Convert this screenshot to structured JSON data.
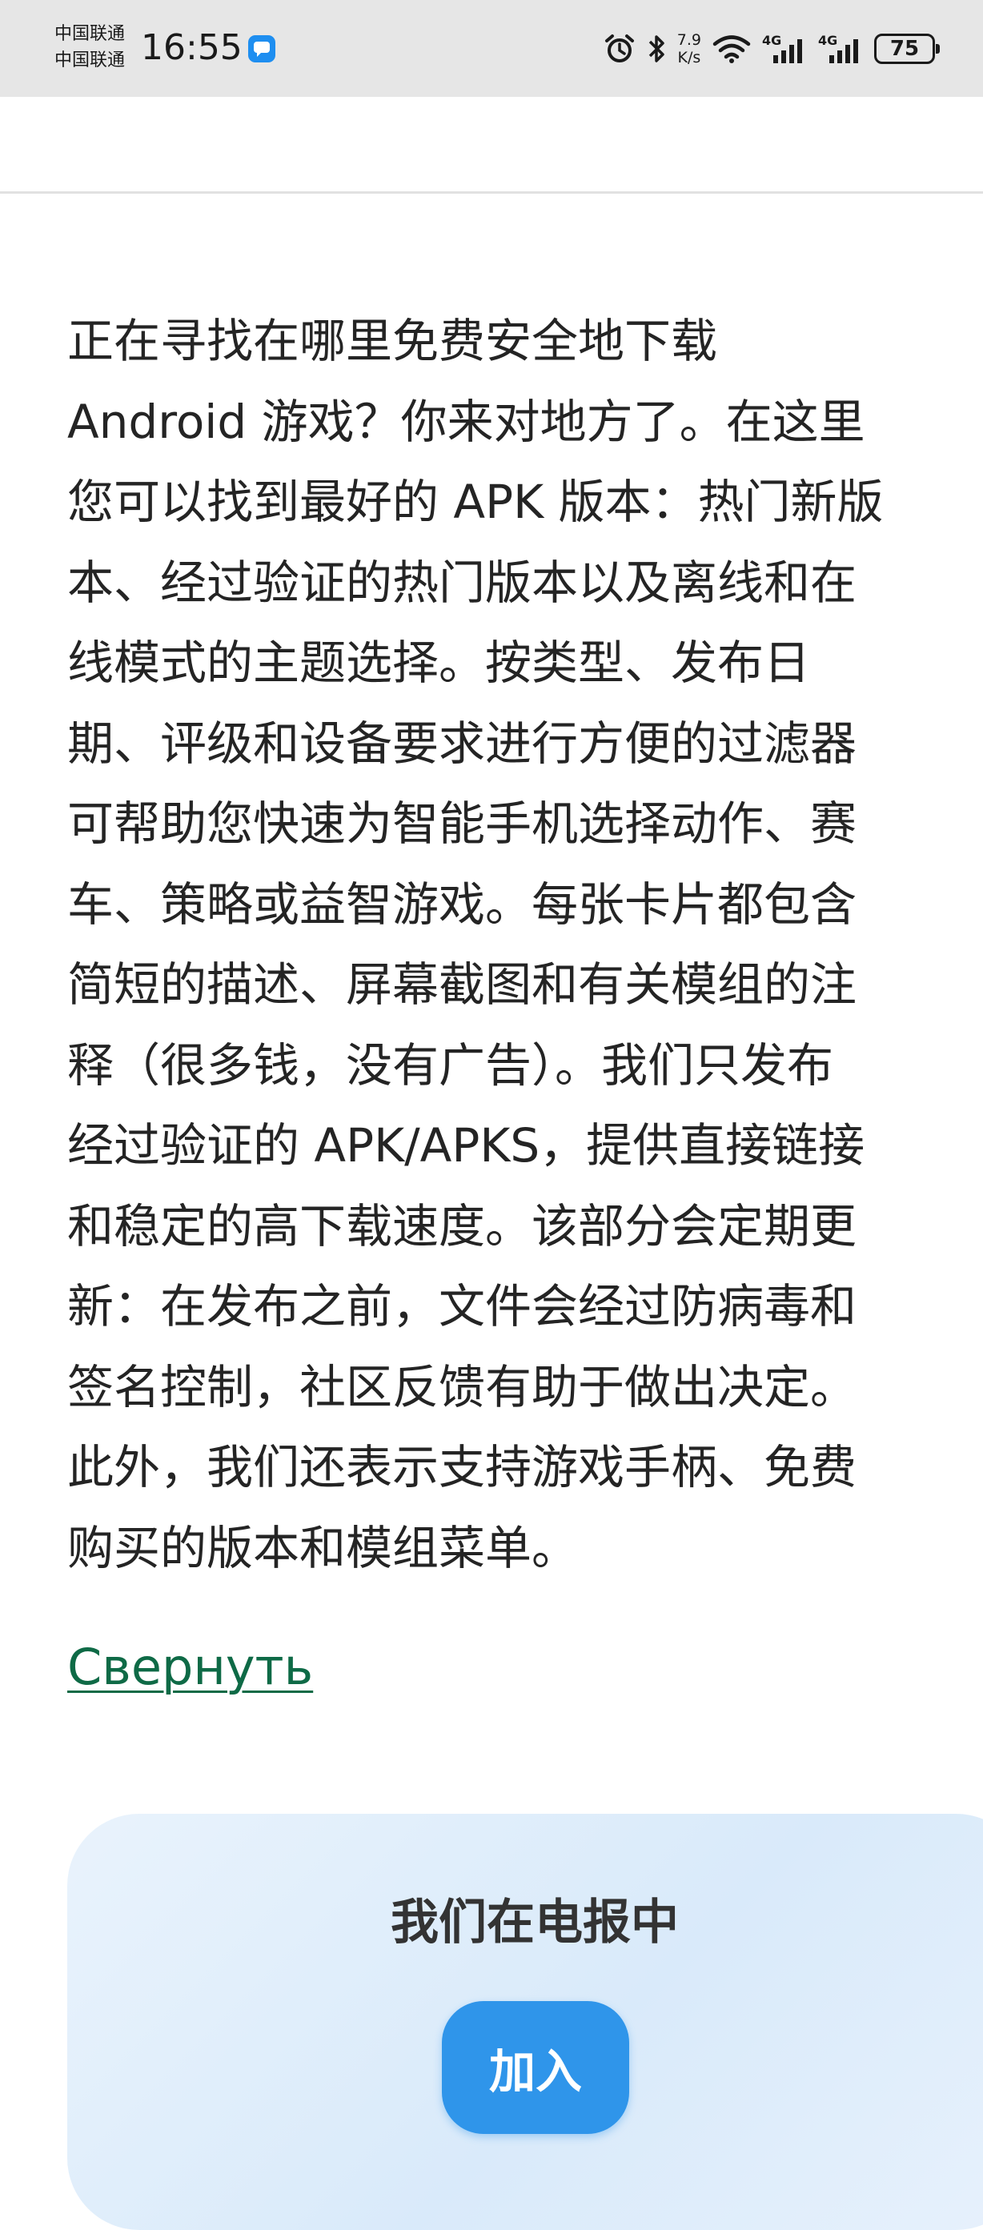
{
  "status_bar": {
    "carrier_1": "中国联通",
    "carrier_2": "中国联通",
    "time": "16:55",
    "net_speed_value": "7.9",
    "net_speed_unit": "K/s",
    "network_1": "4G",
    "network_2": "4G",
    "battery": "75",
    "icons": [
      "message-icon",
      "alarm-icon",
      "bluetooth-icon",
      "wifi-icon",
      "signal-icon",
      "battery-icon"
    ]
  },
  "description": {
    "lines": [
      "正在寻找在哪里免费安全地下载",
      "Android 游戏？你来对地方了。在这里",
      "您可以找到最好的 APK 版本：热门新版",
      "本、经过验证的热门版本以及离线和在",
      "线模式的主题选择。按类型、发布日",
      "期、评级和设备要求进行方便的过滤器",
      "可帮助您快速为智能手机选择动作、赛",
      "车、策略或益智游戏。每张卡片都包含",
      "简短的描述、屏幕截图和有关模组的注",
      "释（很多钱，没有广告）。我们只发布",
      "经过验证的 APK/APKS，提供直接链接",
      "和稳定的高下载速度。该部分会定期更",
      "新：在发布之前，文件会经过防病毒和",
      "签名控制，社区反馈有助于做出决定。",
      "此外，我们还表示支持游戏手柄、免费",
      "购买的版本和模组菜单。"
    ]
  },
  "collapse_link": "Свернуть",
  "telegram": {
    "title": "我们在电报中",
    "join_label": "加入"
  },
  "colors": {
    "link": "#0e6a46",
    "join_button": "#2f95ea",
    "card_bg": "#e3effb"
  }
}
